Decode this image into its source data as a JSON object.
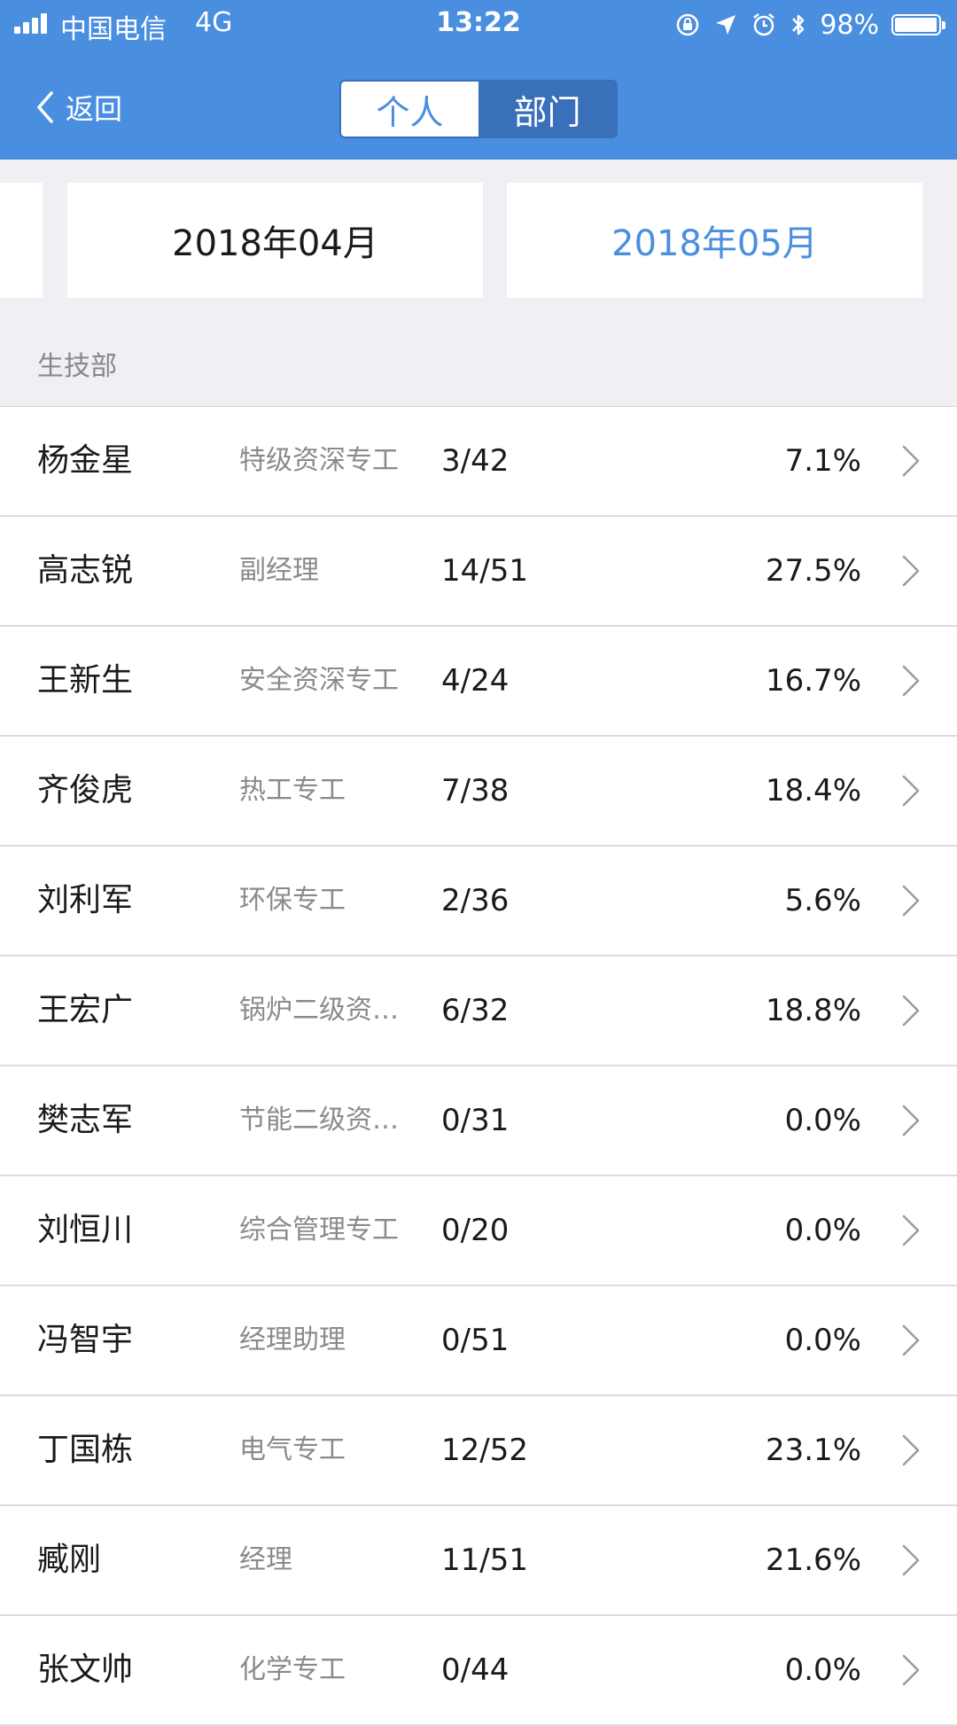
{
  "status_bar": {
    "carrier": "中国电信",
    "network": "4G",
    "time": "13:22",
    "battery": "98%"
  },
  "nav": {
    "back_label": "返回",
    "segments": [
      "个人",
      "部门"
    ],
    "active_segment": "个人"
  },
  "months": {
    "month1": "2018年04月",
    "month2": "2018年05月",
    "selected": "2018年05月"
  },
  "section": {
    "title": "生技部"
  },
  "people": [
    {
      "name": "杨金星",
      "title": "特级资深专工",
      "ratio": "3/42",
      "percent": "7.1%"
    },
    {
      "name": "高志锐",
      "title": "副经理",
      "ratio": "14/51",
      "percent": "27.5%"
    },
    {
      "name": "王新生",
      "title": "安全资深专工",
      "ratio": "4/24",
      "percent": "16.7%"
    },
    {
      "name": "齐俊虎",
      "title": "热工专工",
      "ratio": "7/38",
      "percent": "18.4%"
    },
    {
      "name": "刘利军",
      "title": "环保专工",
      "ratio": "2/36",
      "percent": "5.6%"
    },
    {
      "name": "王宏广",
      "title": "锅炉二级资…",
      "ratio": "6/32",
      "percent": "18.8%"
    },
    {
      "name": "樊志军",
      "title": "节能二级资…",
      "ratio": "0/31",
      "percent": "0.0%"
    },
    {
      "name": "刘恒川",
      "title": "综合管理专工",
      "ratio": "0/20",
      "percent": "0.0%"
    },
    {
      "name": "冯智宇",
      "title": "经理助理",
      "ratio": "0/51",
      "percent": "0.0%"
    },
    {
      "name": "丁国栋",
      "title": "电气专工",
      "ratio": "12/52",
      "percent": "23.1%"
    },
    {
      "name": "臧刚",
      "title": "经理",
      "ratio": "11/51",
      "percent": "21.6%"
    },
    {
      "name": "张文帅",
      "title": "化学专工",
      "ratio": "0/44",
      "percent": "0.0%"
    }
  ],
  "colors": {
    "header_bg": "#4a8ee0",
    "accent": "#4a8ee0",
    "page_bg": "#efeff4"
  },
  "icons": {
    "signal": "signal-bars-icon",
    "rotation_lock": "rotation-lock-icon",
    "location": "location-arrow-icon",
    "alarm": "alarm-clock-icon",
    "bluetooth": "bluetooth-icon",
    "battery": "battery-icon",
    "back": "chevron-left-icon",
    "row_chevron": "chevron-right-icon"
  }
}
